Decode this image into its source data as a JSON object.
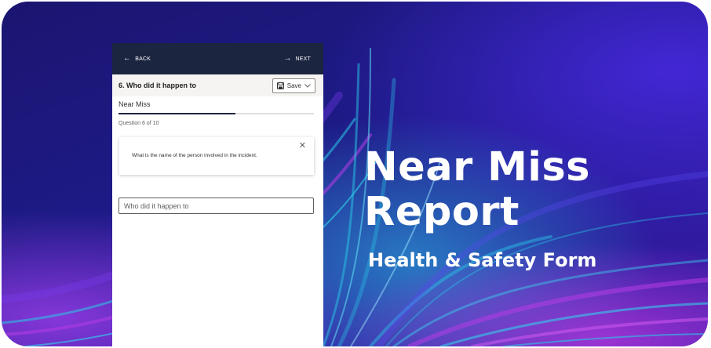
{
  "colors": {
    "background_deep": "#1d1a86",
    "accent_cyan": "#28c8e6",
    "accent_purple": "#b43ce6",
    "form_header": "#1b2540",
    "progress_fill": "#1b2540"
  },
  "form": {
    "back_label": "BACK",
    "next_label": "NEXT",
    "question_title": "6. Who did it happen to",
    "save_label": "Save",
    "form_name": "Near Miss",
    "progress": {
      "current": 6,
      "total": 10,
      "fraction": 0.6
    },
    "question_counter": "Question 6 of 10",
    "hint_text": "What is the name of the person involved in the incident.",
    "answer_placeholder": "Who did it happen to",
    "icons": {
      "back": "arrow-left-icon",
      "next": "arrow-right-icon",
      "save": "save-icon",
      "save_menu": "chevron-down-icon",
      "close": "close-icon"
    }
  },
  "title": {
    "line1": "Near Miss",
    "line2": "Report",
    "subtitle": "Health & Safety Form"
  }
}
